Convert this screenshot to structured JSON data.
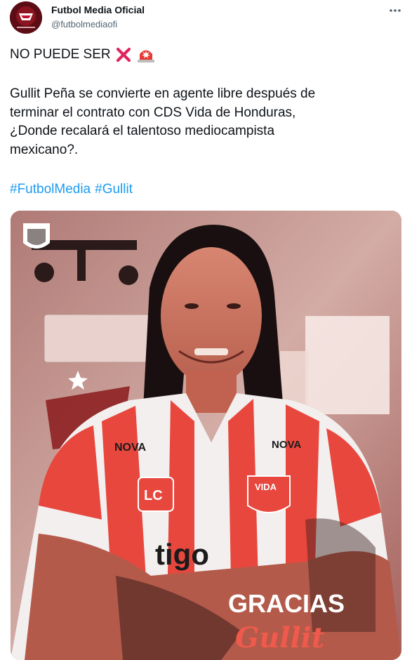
{
  "author": {
    "name": "Futbol Media Oficial",
    "handle": "@futbolmediaofi"
  },
  "tweet": {
    "headline": "NO PUEDE SER",
    "headline_emojis": [
      "cross-mark-icon",
      "police-light-icon"
    ],
    "paragraph_lines": [
      "Gullit Peña se convierte en agente libre después de",
      "terminar el contrato con CDS Vida de Honduras,",
      "¿Donde recalará el talentoso mediocampista",
      "mexicano?."
    ],
    "hashtags": [
      "#FutbolMedia",
      "#Gullit"
    ]
  },
  "media": {
    "overlay_title": "GRACIAS",
    "overlay_script": "Gullit",
    "jersey_text": [
      "NOVA",
      "VIDA",
      "LC",
      "tigo"
    ]
  },
  "colors": {
    "text": "#0f1419",
    "muted": "#536471",
    "link": "#1d9bf0",
    "jersey_red": "#e8473e"
  }
}
